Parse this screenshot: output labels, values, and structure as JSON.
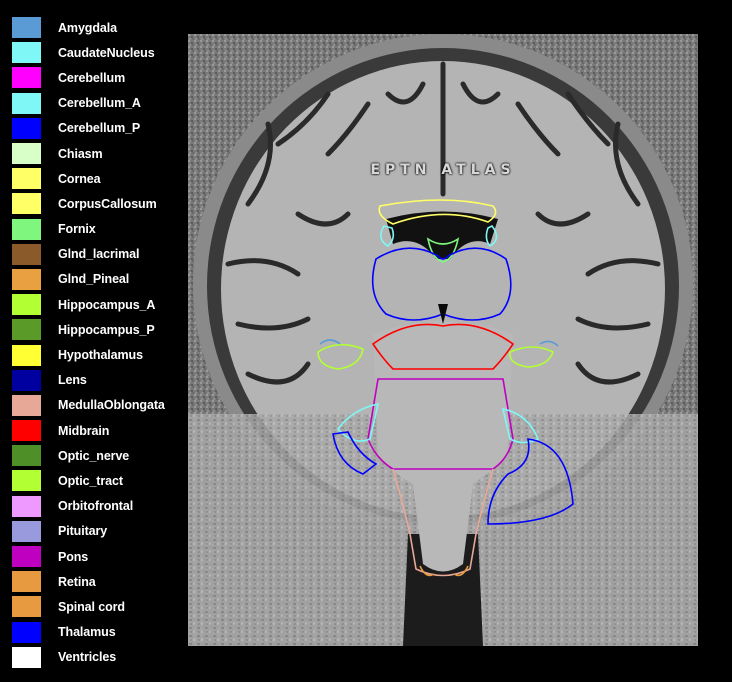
{
  "legend": {
    "items": [
      {
        "label": "Amygdala",
        "color": "#5b9bd5"
      },
      {
        "label": "CaudateNucleus",
        "color": "#7ff7f7"
      },
      {
        "label": "Cerebellum",
        "color": "#ff00ff"
      },
      {
        "label": "Cerebellum_A",
        "color": "#7ff7f7"
      },
      {
        "label": "Cerebellum_P",
        "color": "#0000ff"
      },
      {
        "label": "Chiasm",
        "color": "#d9ffc8"
      },
      {
        "label": "Cornea",
        "color": "#ffff66"
      },
      {
        "label": "CorpusCallosum",
        "color": "#ffff66"
      },
      {
        "label": "Fornix",
        "color": "#7ff77f"
      },
      {
        "label": "Glnd_lacrimal",
        "color": "#8b5a2b"
      },
      {
        "label": "Glnd_Pineal",
        "color": "#e8a040"
      },
      {
        "label": "Hippocampus_A",
        "color": "#b2ff33"
      },
      {
        "label": "Hippocampus_P",
        "color": "#5a9a28"
      },
      {
        "label": "Hypothalamus",
        "color": "#ffff33"
      },
      {
        "label": "Lens",
        "color": "#0000a0"
      },
      {
        "label": "MedullaOblongata",
        "color": "#e8a898"
      },
      {
        "label": "Midbrain",
        "color": "#ff0000"
      },
      {
        "label": "Optic_nerve",
        "color": "#4f8f28"
      },
      {
        "label": "Optic_tract",
        "color": "#b2ff33"
      },
      {
        "label": "Orbitofrontal",
        "color": "#ee99ff"
      },
      {
        "label": "Pituitary",
        "color": "#9999dd"
      },
      {
        "label": "Pons",
        "color": "#c000c0"
      },
      {
        "label": "Retina",
        "color": "#e89a40"
      },
      {
        "label": "Spinal cord",
        "color": "#e89a40"
      },
      {
        "label": "Thalamus",
        "color": "#0000ff"
      },
      {
        "label": "Ventricles",
        "color": "#ffffff"
      }
    ]
  },
  "image": {
    "watermark": "EPTN ATLAS"
  },
  "contour_colors": {
    "corpus_callosum": "#ffff66",
    "caudate": "#7ff7f7",
    "fornix": "#7ff77f",
    "thalamus": "#0000ff",
    "midbrain": "#ff0000",
    "pons": "#c000c0",
    "medulla": "#e8a898",
    "cerebellum_a": "#7ff7f7",
    "cerebellum_p": "#0000ff",
    "hippocampus_a": "#b2ff33",
    "amygdala": "#5b9bd5",
    "spinal_cord": "#e89a40"
  }
}
